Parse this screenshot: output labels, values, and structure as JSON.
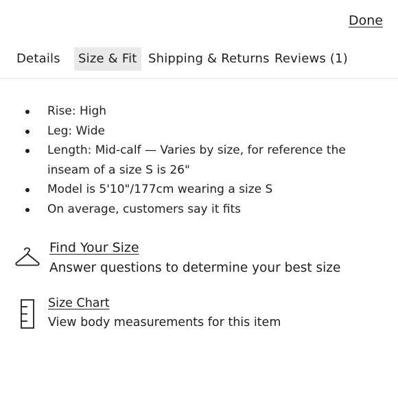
{
  "header": {
    "done_label": "Done"
  },
  "tabs": [
    {
      "label": "Details",
      "active": false
    },
    {
      "label": "Size & Fit",
      "active": true
    },
    {
      "label": "Shipping & Returns",
      "active": false
    },
    {
      "label": "Reviews (1)",
      "active": false
    }
  ],
  "fit_details": [
    "Rise: High",
    "Leg: Wide",
    "Length: Mid-calf — Varies by size, for reference the inseam of a size S is 26\"",
    "Model is 5'10\"/177cm wearing a size S",
    "On average, customers say it fits"
  ],
  "find_your_size": {
    "icon": "hanger-icon",
    "title": "Find Your Size",
    "description": "Answer questions to determine your best size"
  },
  "size_chart": {
    "icon": "ruler-icon",
    "title": "Size Chart",
    "description": "View body measurements for this item"
  },
  "colors": {
    "text": "#1f1f1f",
    "active_tab_bg": "#e9e9e9",
    "divider": "#e3e3e3"
  }
}
